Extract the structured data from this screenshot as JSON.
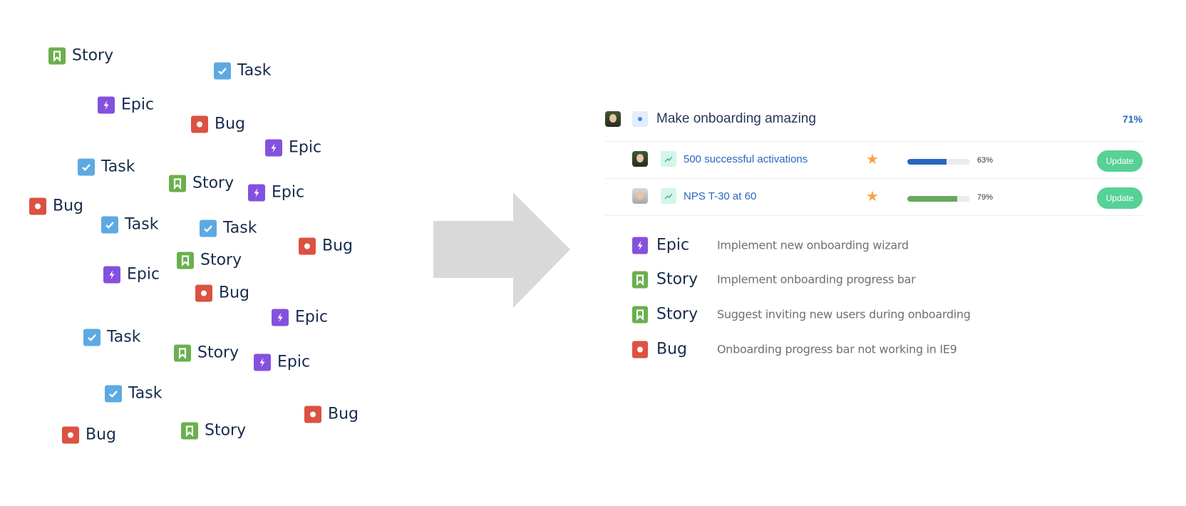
{
  "colors": {
    "Story": "#6ab04c",
    "Task": "#5ea9e2",
    "Epic": "#8451de",
    "Bug": "#dc5142",
    "update_button": "#57d195",
    "arrow": "#d9d9d9"
  },
  "scattered_issues": [
    {
      "type": "Story",
      "label": "Story"
    },
    {
      "type": "Task",
      "label": "Task"
    },
    {
      "type": "Epic",
      "label": "Epic"
    },
    {
      "type": "Bug",
      "label": "Bug"
    },
    {
      "type": "Epic",
      "label": "Epic"
    },
    {
      "type": "Task",
      "label": "Task"
    },
    {
      "type": "Story",
      "label": "Story"
    },
    {
      "type": "Epic",
      "label": "Epic"
    },
    {
      "type": "Bug",
      "label": "Bug"
    },
    {
      "type": "Task",
      "label": "Task"
    },
    {
      "type": "Task",
      "label": "Task"
    },
    {
      "type": "Bug",
      "label": "Bug"
    },
    {
      "type": "Story",
      "label": "Story"
    },
    {
      "type": "Epic",
      "label": "Epic"
    },
    {
      "type": "Bug",
      "label": "Bug"
    },
    {
      "type": "Epic",
      "label": "Epic"
    },
    {
      "type": "Task",
      "label": "Task"
    },
    {
      "type": "Story",
      "label": "Story"
    },
    {
      "type": "Epic",
      "label": "Epic"
    },
    {
      "type": "Task",
      "label": "Task"
    },
    {
      "type": "Bug",
      "label": "Bug"
    },
    {
      "type": "Bug",
      "label": "Bug"
    },
    {
      "type": "Story",
      "label": "Story"
    }
  ],
  "goal": {
    "title": "Make onboarding amazing",
    "progress_label": "71%",
    "progress": 71
  },
  "key_results": [
    {
      "title": "500 successful activations",
      "starred": true,
      "progress": 63,
      "progress_label": "63%",
      "bar_color": "#2a65c0",
      "button": "Update"
    },
    {
      "title": "NPS T-30 at 60",
      "starred": true,
      "progress": 79,
      "progress_label": "79%",
      "bar_color": "#65aa5b",
      "button": "Update"
    }
  ],
  "linked_issues": [
    {
      "type": "Epic",
      "label": "Epic",
      "summary": "Implement new onboarding wizard"
    },
    {
      "type": "Story",
      "label": "Story",
      "summary": "Implement onboarding progress bar"
    },
    {
      "type": "Story",
      "label": "Story",
      "summary": "Suggest inviting new users during onboarding"
    },
    {
      "type": "Bug",
      "label": "Bug",
      "summary": "Onboarding progress bar not working in IE9"
    }
  ]
}
